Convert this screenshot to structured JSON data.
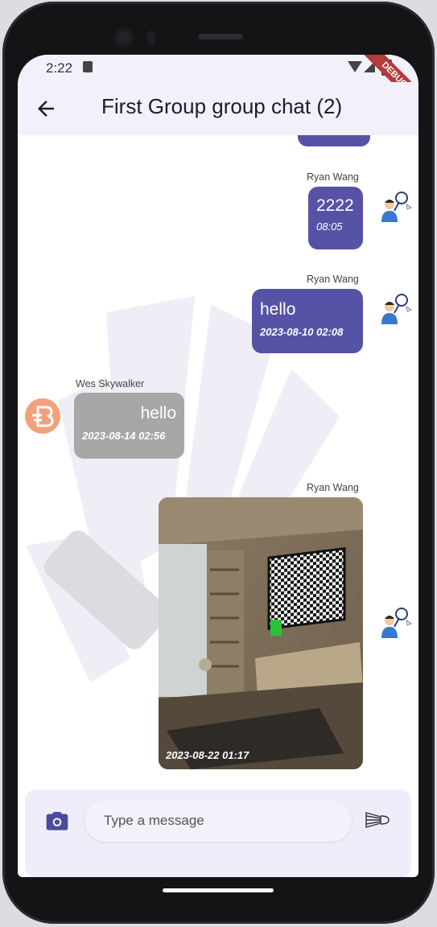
{
  "status_bar": {
    "time": "2:22",
    "debug_label": "DEBUG"
  },
  "app_bar": {
    "title": "First Group group chat (2)"
  },
  "messages": [
    {
      "sender": "Ryan Wang",
      "text": "2222",
      "time": "08:05",
      "direction": "outgoing"
    },
    {
      "sender": "Ryan Wang",
      "text": "hello",
      "time": "2023-08-10 02:08",
      "direction": "outgoing"
    },
    {
      "sender": "Wes Skywalker",
      "text": "hello",
      "time": "2023-08-14 02:56",
      "direction": "incoming"
    },
    {
      "sender": "Ryan Wang",
      "type": "image",
      "time": "2023-08-22 01:17",
      "direction": "outgoing"
    }
  ],
  "composer": {
    "placeholder": "Type a message"
  },
  "colors": {
    "outgoing_bubble": "#5652a6",
    "incoming_bubble": "#a7a7a7",
    "app_bar": "#f2f0fb",
    "accent": "#4a4c9c"
  },
  "icons": [
    "back-arrow-icon",
    "camera-icon",
    "shuttlecock-send-icon",
    "badminton-player-avatar",
    "brand-logo-avatar"
  ]
}
